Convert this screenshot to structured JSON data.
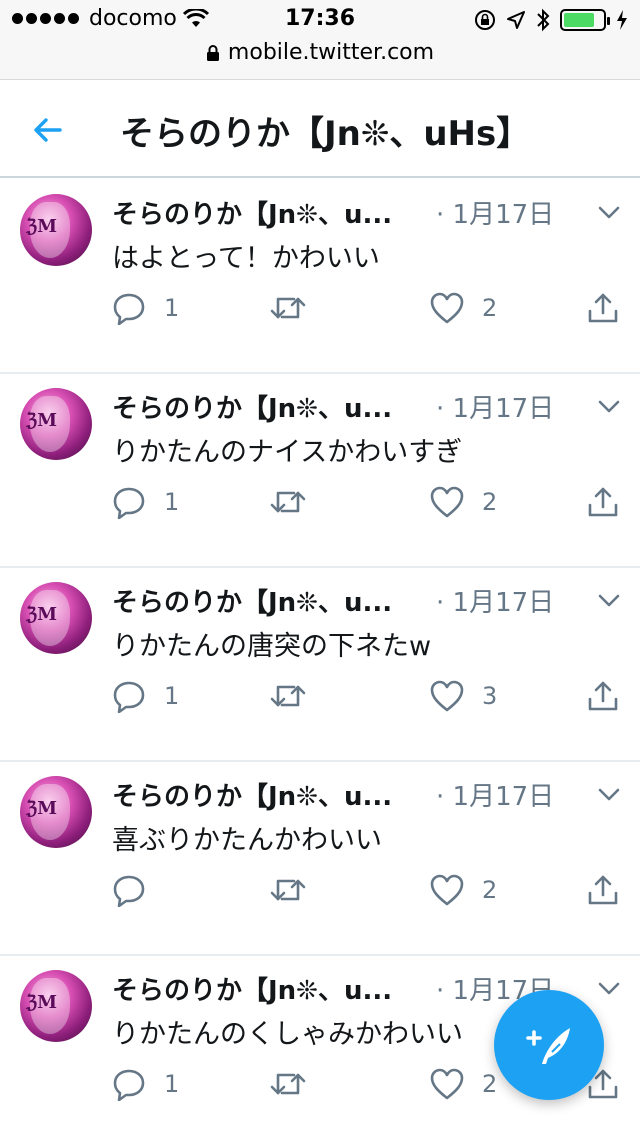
{
  "status_bar": {
    "carrier": "docomo",
    "time": "17:36",
    "battery_level": 0.8
  },
  "url_bar": {
    "url": "mobile.twitter.com"
  },
  "header": {
    "title": "そらのりか【Jn❊、uHs】"
  },
  "tweets": [
    {
      "name": "そらのりか【Jn❊、u...",
      "time": "· 1月17日",
      "text": "はよとって！かわいい",
      "replies": "1",
      "retweets": "",
      "likes": "2"
    },
    {
      "name": "そらのりか【Jn❊、u...",
      "time": "· 1月17日",
      "text": "りかたんのナイスかわいすぎ",
      "replies": "1",
      "retweets": "",
      "likes": "2"
    },
    {
      "name": "そらのりか【Jn❊、u...",
      "time": "· 1月17日",
      "text": "りかたんの唐突の下ネたw",
      "replies": "1",
      "retweets": "",
      "likes": "3"
    },
    {
      "name": "そらのりか【Jn❊、u...",
      "time": "· 1月17日",
      "text": "喜ぶりかたんかわいい",
      "replies": "",
      "retweets": "",
      "likes": "2"
    },
    {
      "name": "そらのりか【Jn❊、u...",
      "time": "· 1月17日",
      "text": "りかたんのくしゃみかわいい",
      "replies": "1",
      "retweets": "",
      "likes": "2"
    }
  ],
  "colors": {
    "accent": "#1da1f2",
    "muted": "#657786",
    "text": "#14171a",
    "divider": "#e6ecf0",
    "battery": "#4cd964"
  },
  "icons": {
    "back": "arrow-left-icon",
    "reply": "reply-icon",
    "retweet": "retweet-icon",
    "like": "heart-icon",
    "share": "share-icon",
    "caret": "chevron-down-icon",
    "compose": "compose-tweet-icon"
  }
}
